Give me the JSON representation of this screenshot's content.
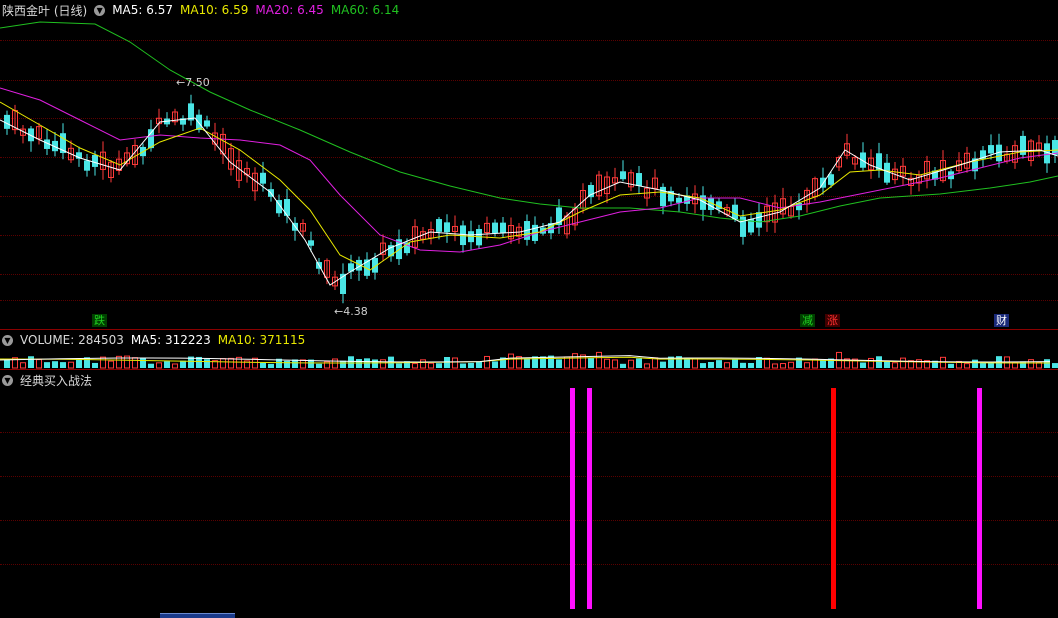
{
  "price_panel": {
    "stock_name": "陕西金叶 (日线)",
    "ma_labels": [
      {
        "text": "MA5: 6.57",
        "color": "#ffffff"
      },
      {
        "text": "MA10: 6.59",
        "color": "#e8e800"
      },
      {
        "text": "MA20: 6.45",
        "color": "#e020e0"
      },
      {
        "text": "MA60: 6.14",
        "color": "#20c020"
      }
    ],
    "high_note": "7.50",
    "low_note": "4.38",
    "tags": [
      {
        "text": "跌",
        "color": "#20d020",
        "bg": "#004000"
      },
      {
        "text": "减",
        "color": "#20d020",
        "bg": "#004000"
      },
      {
        "text": "涨",
        "color": "#ff3030",
        "bg": "#400000"
      },
      {
        "text": "财",
        "color": "#ffffff",
        "bg": "#1a2a7a"
      }
    ]
  },
  "volume_panel": {
    "label": "VOLUME: 284503",
    "ma5_label": "MA5: 312223",
    "ma10_label": "MA10: 371115"
  },
  "signal_panel": {
    "title": "经典买入战法"
  },
  "colors": {
    "background": "#000000",
    "up": "#ff3a3a",
    "down": "#4ae6e6",
    "grid": "#5a0000",
    "ma5": "#ffffff",
    "ma10": "#e8e800",
    "ma20": "#e020e0",
    "ma60": "#20c020",
    "signal_magenta": "#ff10ff",
    "signal_red": "#ff0000"
  }
}
